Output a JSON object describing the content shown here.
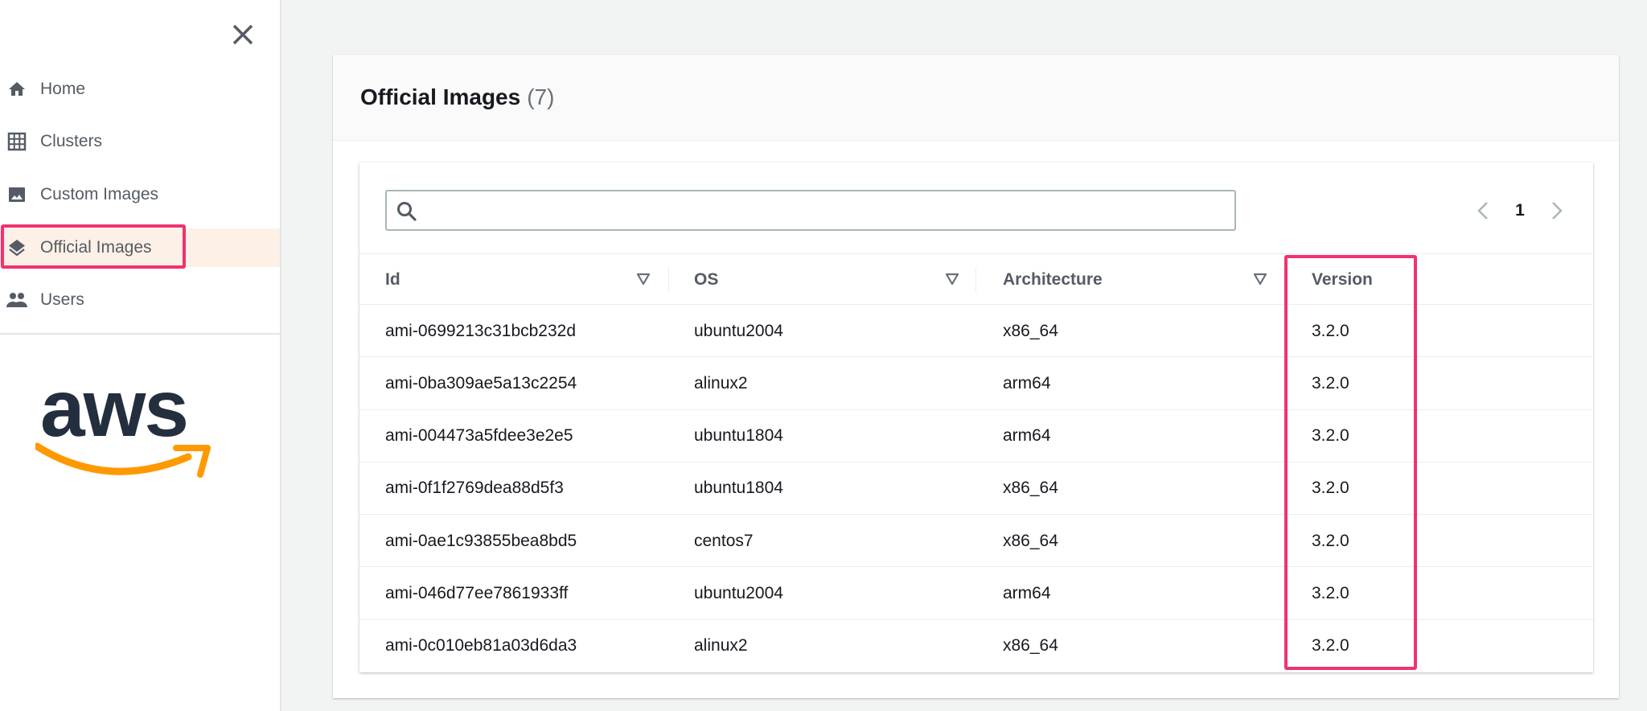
{
  "sidebar": {
    "items": [
      {
        "label": "Home",
        "icon": "home-icon"
      },
      {
        "label": "Clusters",
        "icon": "grid-icon"
      },
      {
        "label": "Custom Images",
        "icon": "image-icon"
      },
      {
        "label": "Official Images",
        "icon": "layers-icon",
        "active": true
      },
      {
        "label": "Users",
        "icon": "users-icon"
      }
    ],
    "logo": "aws"
  },
  "main": {
    "title": "Official Images",
    "count": "(7)",
    "search": {
      "value": "",
      "placeholder": ""
    },
    "pagination": {
      "current_page": "1"
    },
    "columns": [
      "Id",
      "OS",
      "Architecture",
      "Version"
    ],
    "rows": [
      [
        "ami-0699213c31bcb232d",
        "ubuntu2004",
        "x86_64",
        "3.2.0"
      ],
      [
        "ami-0ba309ae5a13c2254",
        "alinux2",
        "arm64",
        "3.2.0"
      ],
      [
        "ami-004473a5fdee3e2e5",
        "ubuntu1804",
        "arm64",
        "3.2.0"
      ],
      [
        "ami-0f1f2769dea88d5f3",
        "ubuntu1804",
        "x86_64",
        "3.2.0"
      ],
      [
        "ami-0ae1c93855bea8bd5",
        "centos7",
        "x86_64",
        "3.2.0"
      ],
      [
        "ami-046d77ee7861933ff",
        "ubuntu2004",
        "arm64",
        "3.2.0"
      ],
      [
        "ami-0c010eb81a03d6da3",
        "alinux2",
        "x86_64",
        "3.2.0"
      ]
    ]
  },
  "colors": {
    "highlight": "#f0336e",
    "active_bg": "#fdf0e6",
    "logo_text": "#232f3e",
    "logo_smile": "#ff9900"
  }
}
